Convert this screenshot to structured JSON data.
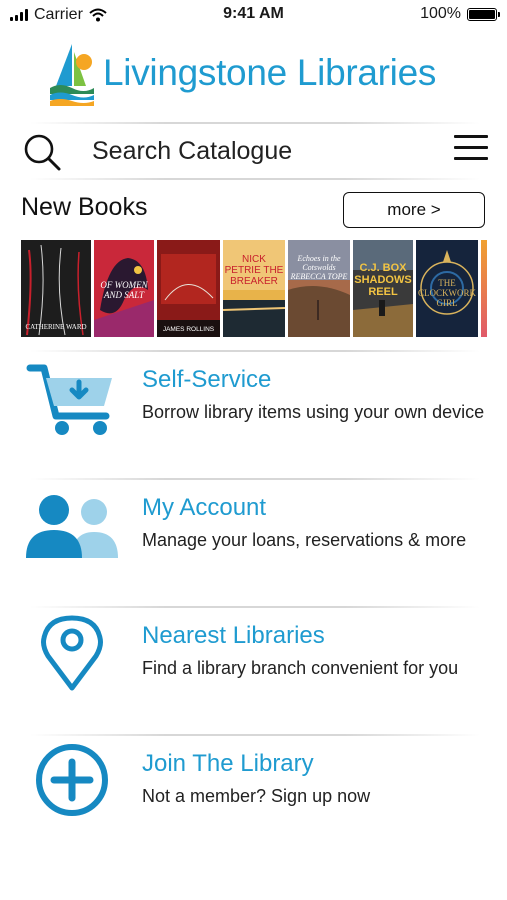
{
  "status_bar": {
    "carrier": "Carrier",
    "time": "9:41 AM",
    "battery": "100%"
  },
  "header": {
    "brand": "Livingstone Libraries"
  },
  "search": {
    "placeholder": "Search Catalogue"
  },
  "new_books": {
    "title": "New Books",
    "more_label": "more >",
    "covers": [
      {
        "title_text": "CATHERINE WARD",
        "bg": "#1d1d1d",
        "accent": "#c8202c"
      },
      {
        "title_text": "OF WOMEN AND SALT",
        "bg": "#c9283a",
        "accent": "#2a1830"
      },
      {
        "title_text": "JAMES ROLLINS",
        "bg": "#8a1a18",
        "accent": "#e8e0d6"
      },
      {
        "title_text": "NICK PETRIE THE BREAKER",
        "bg": "#e8b34a",
        "accent": "#1e2a33"
      },
      {
        "title_text": "Echoes in the Cotswolds REBECCA TOPE",
        "bg": "#a76a4a",
        "accent": "#3d2a22"
      },
      {
        "title_text": "C.J. BOX SHADOWS REEL",
        "bg": "#3a3a3a",
        "accent": "#f2c443"
      },
      {
        "title_text": "THE CLOCKWORK GIRL",
        "bg": "#15243c",
        "accent": "#d9b35c"
      }
    ]
  },
  "menu": [
    {
      "title": "Self-Service",
      "desc": "Borrow library items using your own device",
      "icon": "cart-icon"
    },
    {
      "title": "My Account",
      "desc": "Manage your loans, reservations & more",
      "icon": "users-icon"
    },
    {
      "title": "Nearest Libraries",
      "desc": "Find a library branch convenient for you",
      "icon": "location-pin-icon"
    },
    {
      "title": "Join The Library",
      "desc": "Not a member? Sign up now",
      "icon": "plus-circle-icon"
    }
  ],
  "colors": {
    "brand_blue": "#1f9bd0",
    "icon_dark": "#1689c2",
    "icon_light": "#9ed2ea"
  }
}
